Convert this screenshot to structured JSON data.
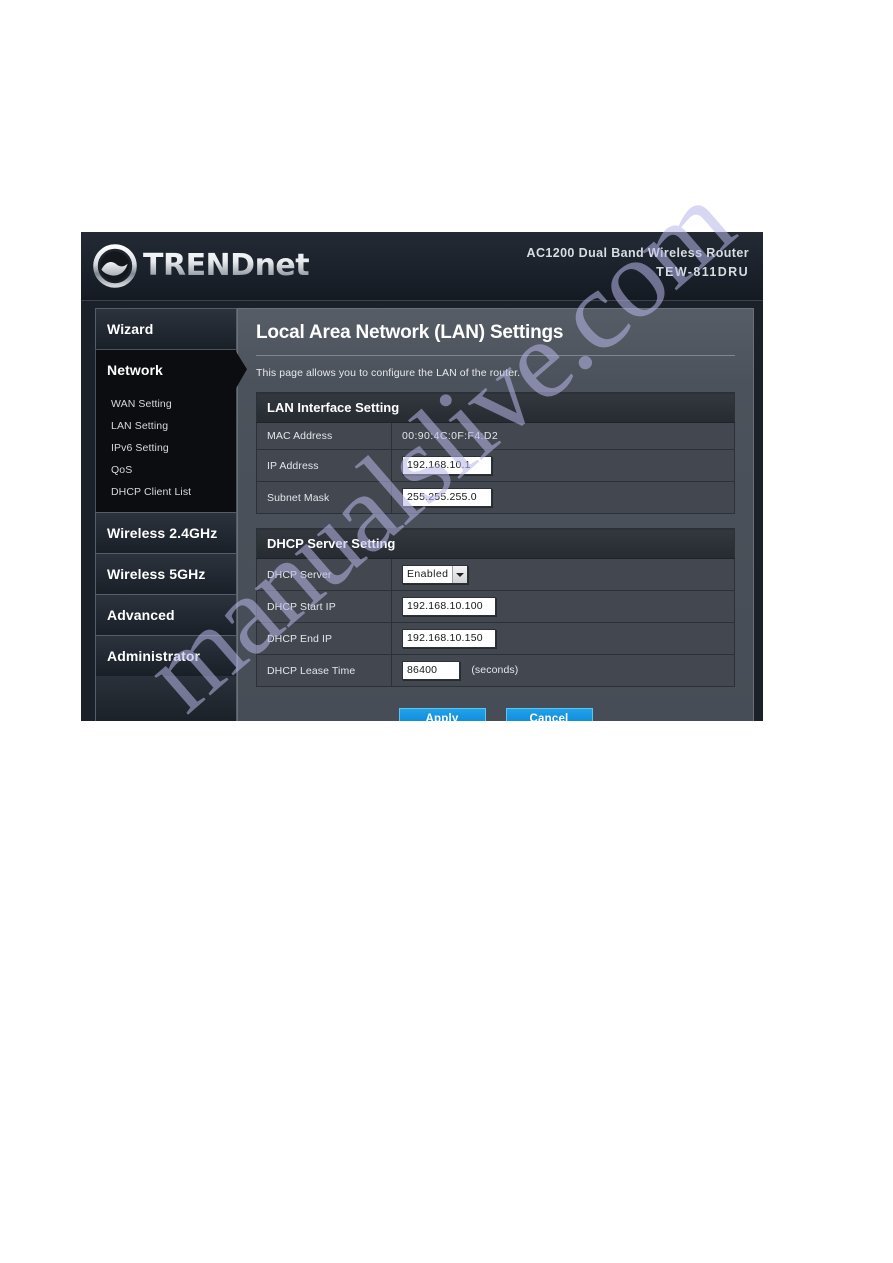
{
  "banner": {
    "logo_icon": "trendnet-circle-swoosh-logo",
    "logo_text": "TRENDnet",
    "model_line1": "AC1200 Dual Band Wireless Router",
    "model_line2": "TEW-811DRU"
  },
  "sidebar": {
    "items": [
      {
        "label": "Wizard",
        "active": false
      },
      {
        "label": "Network",
        "active": true
      },
      {
        "label": "Wireless 2.4GHz",
        "active": false
      },
      {
        "label": "Wireless 5GHz",
        "active": false
      },
      {
        "label": "Advanced",
        "active": false
      },
      {
        "label": "Administrator",
        "active": false
      }
    ],
    "submenu": [
      {
        "label": "WAN Setting"
      },
      {
        "label": "LAN Setting"
      },
      {
        "label": "IPv6 Setting"
      },
      {
        "label": "QoS"
      },
      {
        "label": "DHCP Client List"
      }
    ]
  },
  "main": {
    "title": "Local Area Network (LAN) Settings",
    "description": "This page allows you to configure the LAN of the router.",
    "lan_section": {
      "heading": "LAN Interface Setting",
      "rows": [
        {
          "label": "MAC Address",
          "value": "00:90:4C:0F:F4:D2"
        },
        {
          "label": "IP Address",
          "value": "192.168.10.1"
        },
        {
          "label": "Subnet Mask",
          "value": "255.255.255.0"
        }
      ]
    },
    "dhcp_section": {
      "heading": "DHCP Server Setting",
      "server_label": "DHCP Server",
      "server_value": "Enabled",
      "start_label": "DHCP Start IP",
      "start_value": "192.168.10.100",
      "end_label": "DHCP End IP",
      "end_value": "192.168.10.150",
      "lease_label": "DHCP Lease Time",
      "lease_value": "86400",
      "lease_unit": "(seconds)"
    },
    "buttons": {
      "apply": "Apply",
      "cancel": "Cancel"
    }
  },
  "watermark": {
    "text": "manualslive.com"
  },
  "colors": {
    "accent_button": "#1592de",
    "banner_bg": "#1e252f",
    "panel_bg": "#4c525b",
    "sidebar_active": "#0c0d10"
  }
}
